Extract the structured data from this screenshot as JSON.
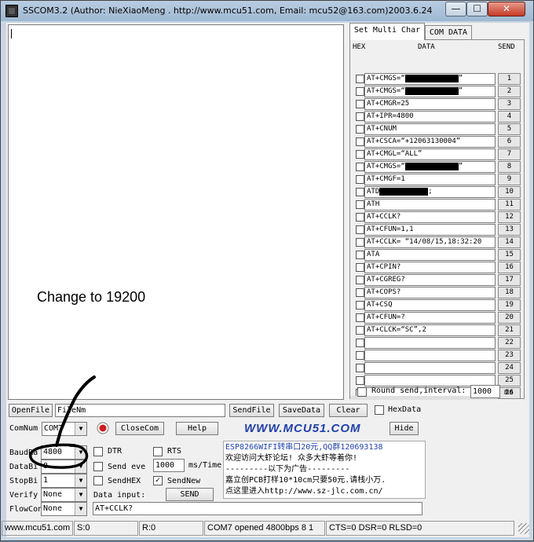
{
  "window": {
    "title": "SSCOM3.2 (Author: NieXiaoMeng .  http://www.mcu51.com,  Email: mcu52@163.com)2003.6.24",
    "min_glyph": "—",
    "max_glyph": "☐",
    "close_glyph": "✕"
  },
  "annotation": {
    "text": "Change to 19200"
  },
  "tabs": [
    {
      "label": "Set Multi Char"
    },
    {
      "label": "COM DATA"
    }
  ],
  "table_headers": {
    "hex": "HEX",
    "data": "DATA",
    "send": "SEND"
  },
  "commands": [
    {
      "pre": "AT+CMGS=“",
      "redacted": true,
      "post": "”",
      "send": "1"
    },
    {
      "pre": "AT+CMGS=“",
      "redacted": true,
      "post": "”",
      "send": "2"
    },
    {
      "pre": "AT+CMGR=25",
      "redacted": false,
      "post": "",
      "send": "3"
    },
    {
      "pre": "AT+IPR=4800",
      "redacted": false,
      "post": "",
      "send": "4"
    },
    {
      "pre": "AT+CNUM",
      "redacted": false,
      "post": "",
      "send": "5"
    },
    {
      "pre": "AT+CSCA=“+12063130004”",
      "redacted": false,
      "post": "",
      "send": "6"
    },
    {
      "pre": "AT+CMGL=“ALL”",
      "redacted": false,
      "post": "",
      "send": "7"
    },
    {
      "pre": "AT+CMGS=“",
      "redacted": true,
      "post": "”",
      "send": "8"
    },
    {
      "pre": "AT+CMGF=1",
      "redacted": false,
      "post": "",
      "send": "9"
    },
    {
      "pre": "ATD",
      "redacted": true,
      "post": ";",
      "send": "10"
    },
    {
      "pre": "ATH",
      "redacted": false,
      "post": "",
      "send": "11"
    },
    {
      "pre": "AT+CCLK?",
      "redacted": false,
      "post": "",
      "send": "12"
    },
    {
      "pre": "AT+CFUN=1,1",
      "redacted": false,
      "post": "",
      "send": "13"
    },
    {
      "pre": "AT+CCLK= “14/08/15,18:32:20",
      "redacted": false,
      "post": "",
      "send": "14"
    },
    {
      "pre": "ATA",
      "redacted": false,
      "post": "",
      "send": "15"
    },
    {
      "pre": "AT+CPIN?",
      "redacted": false,
      "post": "",
      "send": "16"
    },
    {
      "pre": "AT+CGREG?",
      "redacted": false,
      "post": "",
      "send": "17"
    },
    {
      "pre": "AT+COPS?",
      "redacted": false,
      "post": "",
      "send": "18"
    },
    {
      "pre": "AT+CSQ",
      "redacted": false,
      "post": "",
      "send": "19"
    },
    {
      "pre": "AT+CFUN=?",
      "redacted": false,
      "post": "",
      "send": "20"
    },
    {
      "pre": "AT+CLCK=“SC”,2",
      "redacted": false,
      "post": "",
      "send": "21"
    },
    {
      "pre": "",
      "redacted": false,
      "post": "",
      "send": "22"
    },
    {
      "pre": "",
      "redacted": false,
      "post": "",
      "send": "23"
    },
    {
      "pre": "",
      "redacted": false,
      "post": "",
      "send": "24"
    },
    {
      "pre": "",
      "redacted": false,
      "post": "",
      "send": "25"
    },
    {
      "pre": "",
      "redacted": false,
      "post": "",
      "send": "26"
    }
  ],
  "round_send": {
    "label": "Round send,interval:",
    "value": "1000",
    "unit": "ms"
  },
  "file_row": {
    "open_file": "OpenFile",
    "file_name": "FileNm",
    "send_file": "SendFile",
    "save_data": "SaveData",
    "clear": "Clear",
    "hex_data": "HexData"
  },
  "com_row": {
    "comnum_label": "ComNum",
    "comnum_value": "COM7",
    "close_com": "CloseCom",
    "help": "Help",
    "logo": "WWW.MCU51.COM",
    "hide": "Hide"
  },
  "settings": {
    "baudrate_label": "BaudRa",
    "baudrate_value": "4800",
    "databits_label": "DataBi",
    "databits_value": "8",
    "stopbits_label": "StopBi",
    "stopbits_value": "1",
    "verify_label": "Verify",
    "verify_value": "None",
    "flowcon_label": "FlowCon",
    "flowcon_value": "None"
  },
  "options": {
    "dtr": "DTR",
    "rts": "RTS",
    "send_every": "Send eve",
    "interval_value": "1000",
    "interval_unit": "ms/Time",
    "send_hex": "SendHEX",
    "send_new": "SendNew",
    "data_input_label": "Data input:",
    "send_button": "SEND",
    "input_value": "AT+CCLK?"
  },
  "ad_lines": [
    "ESP8266WIFI转串口20元,QQ群120693138",
    "欢迎访问大虾论坛! 众多大虾等着你!",
    "---------以下为广告---------",
    "嘉立创PCB打样10*10cm只要50元.请栈小万.",
    "点这里进入http://www.sz-jlc.com.cn/"
  ],
  "status": {
    "site": "www.mcu51.com",
    "sent": "S:0",
    "received": "R:0",
    "port_state": "COM7 opened 4800bps 8 1",
    "lines": "CTS=0 DSR=0 RLSD=0"
  }
}
